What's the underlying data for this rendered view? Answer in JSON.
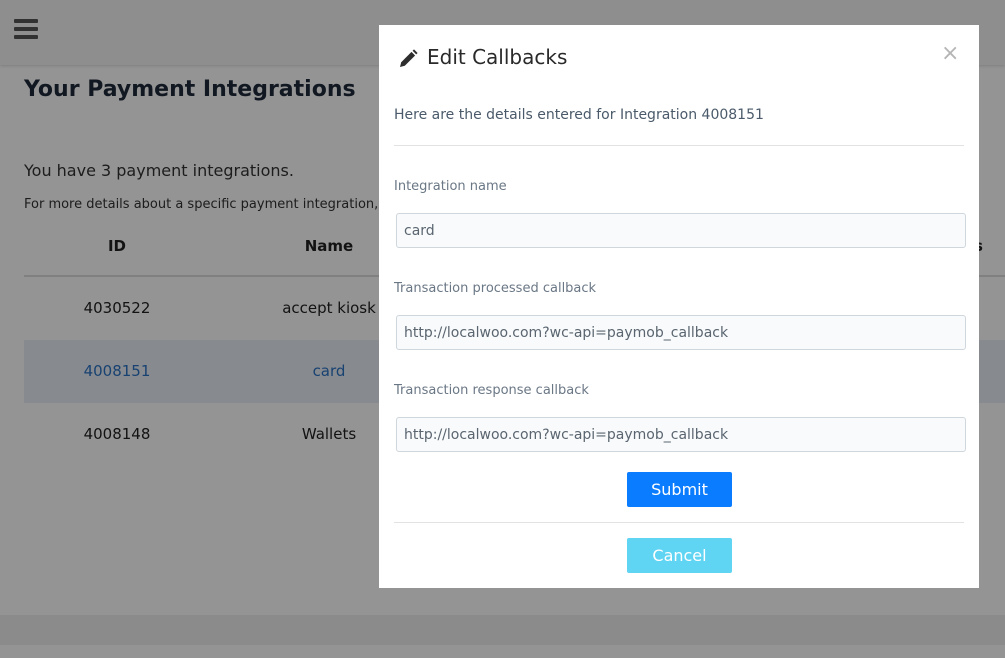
{
  "page": {
    "title": "Your Payment Integrations",
    "count_text": "You have 3 payment integrations.",
    "hint_text": "For more details about a specific payment integration,",
    "table": {
      "headers": [
        "ID",
        "Name",
        "s"
      ],
      "rows": [
        {
          "id": "4030522",
          "name": "accept kiosk"
        },
        {
          "id": "4008151",
          "name": "card"
        },
        {
          "id": "4008148",
          "name": "Wallets"
        }
      ]
    }
  },
  "modal": {
    "title": "Edit Callbacks",
    "close_symbol": "×",
    "intro": "Here are the details entered for Integration 4008151",
    "fields": [
      {
        "label": "Integration name",
        "value": "card"
      },
      {
        "label": "Transaction processed callback",
        "value": "http://localwoo.com?wc-api=paymob_callback"
      },
      {
        "label": "Transaction response callback",
        "value": "http://localwoo.com?wc-api=paymob_callback"
      }
    ],
    "submit_label": "Submit",
    "cancel_label": "Cancel",
    "colors": {
      "submit": "#0a7cff",
      "cancel": "#5fd4f3"
    },
    "icons": {
      "title": "pencil-icon",
      "close": "close-icon"
    }
  }
}
